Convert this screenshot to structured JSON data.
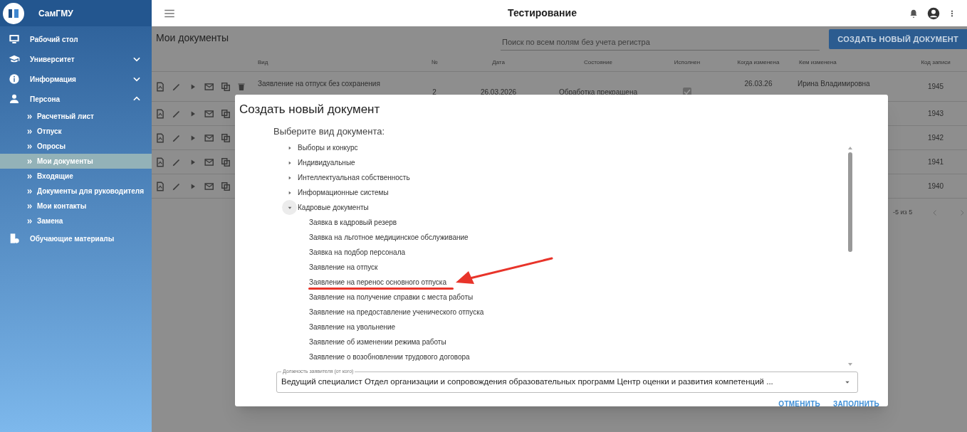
{
  "sidebar": {
    "brand": "СамГМУ",
    "items": [
      {
        "kind": "item",
        "label": "Рабочий стол"
      },
      {
        "kind": "group",
        "label": "Университет",
        "expanded": false
      },
      {
        "kind": "group",
        "label": "Информация",
        "expanded": false
      },
      {
        "kind": "group",
        "label": "Персона",
        "expanded": true,
        "children": [
          {
            "label": "Расчетный лист",
            "selected": false
          },
          {
            "label": "Отпуск",
            "selected": false
          },
          {
            "label": "Опросы",
            "selected": false
          },
          {
            "label": "Мои документы",
            "selected": true
          },
          {
            "label": "Входящие",
            "selected": false
          },
          {
            "label": "Документы для руководителя",
            "selected": false
          },
          {
            "label": "Мои контакты",
            "selected": false
          },
          {
            "label": "Замена",
            "selected": false
          }
        ]
      },
      {
        "kind": "item",
        "label": "Обучающие материалы"
      }
    ]
  },
  "top_bar": {
    "title": "Тестирование"
  },
  "page": {
    "title": "Мои документы",
    "search": {
      "placeholder": "Поиск по всем полям без учета регистра"
    },
    "create_button": "СОЗДАТЬ НОВЫЙ ДОКУМЕНТ"
  },
  "table": {
    "columns": [
      "Вид",
      "№",
      "Дата",
      "Состояние",
      "Исполнен",
      "Когда изменена",
      "Кем изменена",
      "Код записи"
    ],
    "rows": [
      {
        "kind": "full",
        "type": "Заявление на отпуск без сохранения",
        "number": "2",
        "date": "26.03.2026",
        "state": "Обработка прекращена",
        "done": true,
        "changed_at": "26.03.26",
        "changed_by": "Ирина Владимировна",
        "code": "1945"
      },
      {
        "kind": "partial",
        "code": "1943"
      },
      {
        "kind": "partial",
        "code": "1942"
      },
      {
        "kind": "partial",
        "code": "1941"
      },
      {
        "kind": "partial",
        "code": "1940"
      }
    ],
    "pagination": {
      "range": "-5 из 5"
    }
  },
  "dialog": {
    "title": "Создать новый документ",
    "prompt": "Выберите вид документа:",
    "tree": [
      {
        "label": "Выборы и конкурс",
        "expanded": false
      },
      {
        "label": "Индивидуальные",
        "expanded": false
      },
      {
        "label": "Интеллектуальная собственность",
        "expanded": false
      },
      {
        "label": "Информационные системы",
        "expanded": false
      },
      {
        "label": "Кадровые документы",
        "expanded": true,
        "children": [
          {
            "label": "Заявка в кадровый резерв",
            "highlighted": false
          },
          {
            "label": "Заявка на льготное медицинское обслуживание",
            "highlighted": false
          },
          {
            "label": "Заявка на подбор персонала",
            "highlighted": false
          },
          {
            "label": "Заявление на отпуск",
            "highlighted": false
          },
          {
            "label": "Заявление на перенос основного отпуска",
            "highlighted": true
          },
          {
            "label": "Заявление на получение справки с места работы",
            "highlighted": false
          },
          {
            "label": "Заявление на предоставление ученического отпуска",
            "highlighted": false
          },
          {
            "label": "Заявление на увольнение",
            "highlighted": false
          },
          {
            "label": "Заявление об изменении режима работы",
            "highlighted": false
          },
          {
            "label": "Заявление о возобновлении трудового договора",
            "highlighted": false
          }
        ]
      }
    ],
    "select": {
      "label": "Должность заявителя (от кого)",
      "value": "Ведущий специалист Отдел организации и сопровождения образовательных программ Центр оценки и развития компетенций ..."
    },
    "buttons": [
      "ОТМЕНИТЬ",
      "ЗАПОЛНИТЬ"
    ]
  }
}
